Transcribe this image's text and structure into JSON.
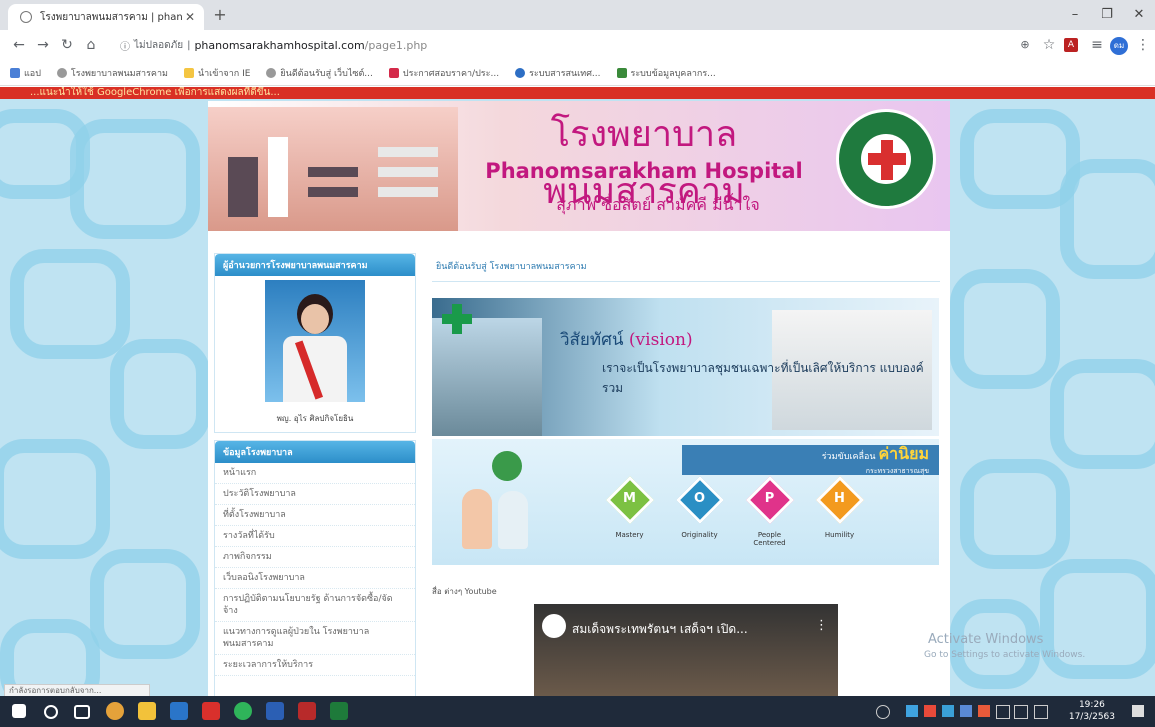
{
  "browser": {
    "tab_title": "โรงพยาบาลพนมสารคาม | phanomsa",
    "security": "ไม่ปลอดภัย",
    "url_host": "phanomsarakhamhospital.com",
    "url_path": "/page1.php",
    "bookmarks": [
      "แอป",
      "โรงพยาบาลพนมสารคาม",
      "นำเข้าจาก IE",
      "ยินดีต้อนรับสู่ เว็บไซต์...",
      "ประกาศสอบราคา/ประ...",
      "ระบบสารสนเทศ...",
      "ระบบข้อมูลบุคลากร..."
    ],
    "profile": "ดม"
  },
  "marquee": "...แนะนำให้ใช้ GoogleChrome เพื่อการแสดงผลที่ดีขึ้น...",
  "banner": {
    "thai_title": "โรงพยาบาลพนมสารคาม",
    "english_title": "Phanomsarakham Hospital",
    "slogan": "สุภาพ ซื่อสัตย์ สามัคคี มีน้ำใจ"
  },
  "sidebar": {
    "director_heading": "ผู้อำนวยการโรงพยาบาลพนมสารคาม",
    "director_name": "พญ. อุไร ศิลปกิจโยธิน",
    "info_heading": "ข้อมูลโรงพยาบาล",
    "menu": [
      "หน้าแรก",
      "ประวัติโรงพยาบาล",
      "ที่ตั้งโรงพยาบาล",
      "รางวัลที่ได้รับ",
      "ภาพกิจกรรม",
      "เว็บลอนิงโรงพยาบาล",
      "การปฏิบัติตามนโยบายรัฐ ด้านการจัดซื้อ/จัดจ้าง",
      "แนวทางการดูแลผู้ป่วยใน โรงพยาบาลพนมสารคาม",
      "ระยะเวลาการให้บริการ"
    ]
  },
  "main": {
    "welcome": "ยินดีต้อนรับสู่ โรงพยาบาลพนมสารคาม",
    "vision_title": "วิสัยทัศน์",
    "vision_en": "(vision)",
    "vision_text": "เราจะเป็นโรงพยาบาลชุมชนเฉพาะที่เป็นเลิศให้บริการ แบบองค์รวม",
    "values_caption": "ร่วมขับเคลื่อน",
    "values_word": "ค่านิยม",
    "values_sub": "กระทรวงสาธารณสุข",
    "values": [
      {
        "letter": "M",
        "label": "Mastery",
        "color": "#7cc142"
      },
      {
        "letter": "O",
        "label": "Originality",
        "color": "#2a8fc4"
      },
      {
        "letter": "P",
        "label": "People Centered",
        "color": "#e0338a"
      },
      {
        "letter": "H",
        "label": "Humility",
        "color": "#f39a1e"
      }
    ],
    "youtube_label": "สื่อ ต่างๆ Youtube",
    "video_title": "สมเด็จพระเทพรัตนฯ เสด็จฯ เปิด..."
  },
  "overlay": {
    "activate_title": "Activate Windows",
    "activate_sub": "Go to Settings to activate Windows.",
    "status_tip": "กำลังรอการตอบกลับจาก..."
  },
  "taskbar": {
    "time": "19:26",
    "date": "17/3/2563"
  }
}
